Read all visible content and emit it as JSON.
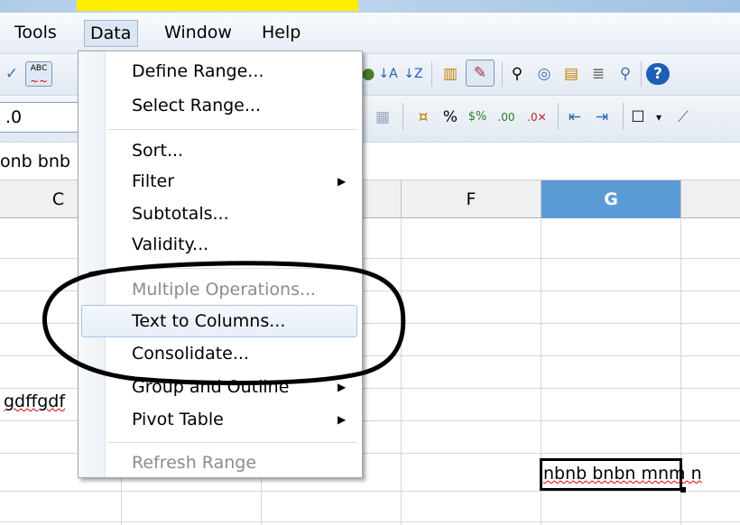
{
  "menubar": {
    "tools": "Tools",
    "data": "Data",
    "window": "Window",
    "help": "Help"
  },
  "toolbar": {
    "font_size_value": ".0"
  },
  "formula_bar": {
    "content": "onb bnb"
  },
  "columns": [
    "C",
    "F",
    "G"
  ],
  "selected_column": "G",
  "cells": {
    "c_row6": "gdffgdf",
    "g_row9": "nbnb bnbn mnm n"
  },
  "data_menu": {
    "items": [
      {
        "label": "Define Range...",
        "enabled": true
      },
      {
        "label": "Select Range...",
        "enabled": true
      },
      {
        "label": "Sort...",
        "enabled": true
      },
      {
        "label": "Filter",
        "enabled": true,
        "submenu": true
      },
      {
        "label": "Subtotals...",
        "enabled": true
      },
      {
        "label": "Validity...",
        "enabled": true
      },
      {
        "label": "Multiple Operations...",
        "enabled": false
      },
      {
        "label": "Text to Columns...",
        "enabled": true,
        "highlighted": true
      },
      {
        "label": "Consolidate...",
        "enabled": true
      },
      {
        "label": "Group and Outline",
        "enabled": true,
        "submenu": true
      },
      {
        "label": "Pivot Table",
        "enabled": true,
        "submenu": true
      },
      {
        "label": "Refresh Range",
        "enabled": false
      }
    ]
  },
  "colors": {
    "selected_column_header": "#5b9bd5",
    "menu_highlight_border": "#a9c4e5",
    "title_highlight": "#ffee00",
    "spellcheck_underline": "#e00000"
  },
  "icons": [
    "spellcheck-icon",
    "autospellcheck-icon",
    "sort-ascending-icon",
    "sort-descending-icon",
    "chart-icon",
    "draw-icon",
    "find-icon",
    "navigator-icon",
    "gallery-icon",
    "datasource-icon",
    "zoom-icon",
    "help-icon",
    "merge-cells-icon",
    "currency-icon",
    "percent-icon",
    "add-decimal-icon",
    "delete-decimal-icon",
    "indent-decrease-icon",
    "indent-increase-icon",
    "border-icon",
    "background-color-icon"
  ]
}
